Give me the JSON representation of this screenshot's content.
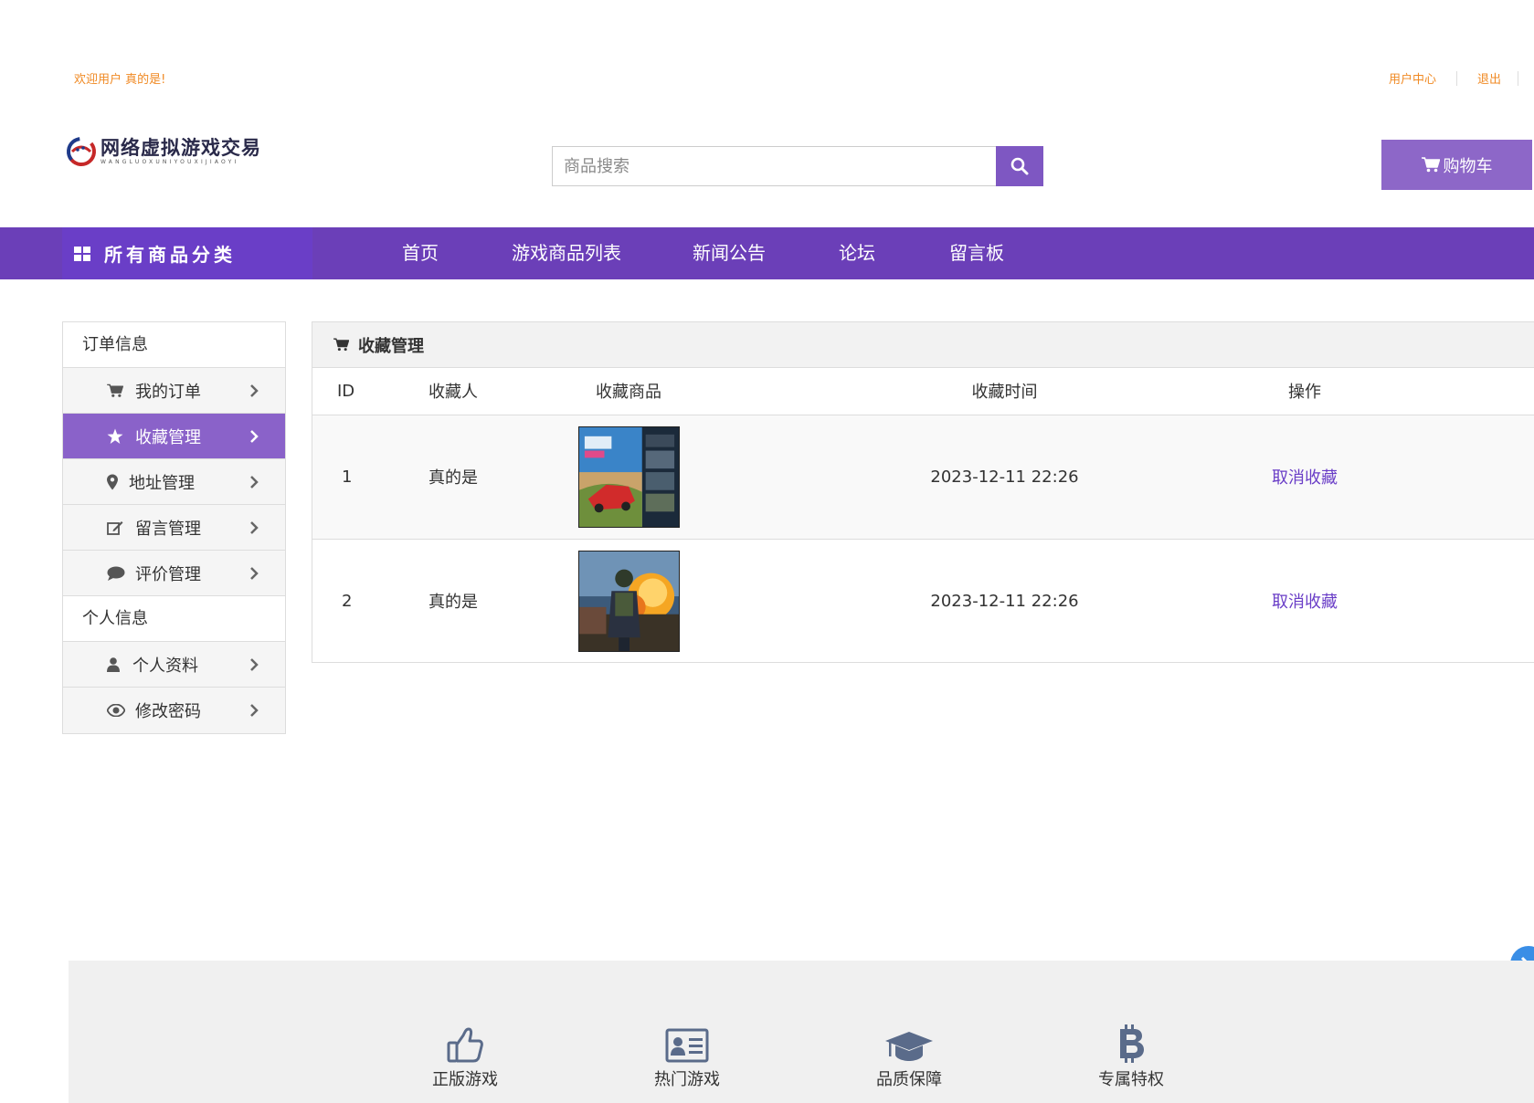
{
  "topbar": {
    "welcome": "欢迎用户 真的是!",
    "user_center": "用户中心",
    "logout": "退出"
  },
  "header": {
    "logo_cn": "网络虚拟游戏交易",
    "logo_en": "WANGLUOXUNIYOUXIJIAOYI",
    "search_placeholder": "商品搜索",
    "cart_label": "购物车"
  },
  "nav": {
    "all_categories": "所有商品分类",
    "items": [
      "首页",
      "游戏商品列表",
      "新闻公告",
      "论坛",
      "留言板"
    ]
  },
  "sidebar": {
    "group1": "订单信息",
    "group1_items": [
      {
        "label": "我的订单",
        "icon": "cart-icon"
      },
      {
        "label": "收藏管理",
        "icon": "star-icon",
        "active": true
      },
      {
        "label": "地址管理",
        "icon": "map-marker-icon"
      },
      {
        "label": "留言管理",
        "icon": "edit-icon"
      },
      {
        "label": "评价管理",
        "icon": "comment-icon"
      }
    ],
    "group2": "个人信息",
    "group2_items": [
      {
        "label": "个人资料",
        "icon": "user-icon"
      },
      {
        "label": "修改密码",
        "icon": "eye-icon"
      }
    ]
  },
  "panel": {
    "title": "收藏管理",
    "columns": [
      "ID",
      "收藏人",
      "收藏商品",
      "收藏时间",
      "操作"
    ],
    "rows": [
      {
        "id": "1",
        "user": "真的是",
        "goods_image": "forza-horizon-cover",
        "time": "2023-12-11 22:26",
        "action": "取消收藏"
      },
      {
        "id": "2",
        "user": "真的是",
        "goods_image": "pubg-cover",
        "time": "2023-12-11 22:26",
        "action": "取消收藏"
      }
    ]
  },
  "footer": {
    "features": [
      {
        "label": "正版游戏",
        "icon": "thumbs-up-icon"
      },
      {
        "label": "热门游戏",
        "icon": "id-card-icon"
      },
      {
        "label": "品质保障",
        "icon": "graduation-cap-icon"
      },
      {
        "label": "专属特权",
        "icon": "bitcoin-icon"
      }
    ]
  },
  "colors": {
    "brand_purple": "#6b3fb8",
    "button_purple": "#7e57c2",
    "welcome_orange": "#f08a24",
    "link_purple": "#6a3ec7"
  }
}
